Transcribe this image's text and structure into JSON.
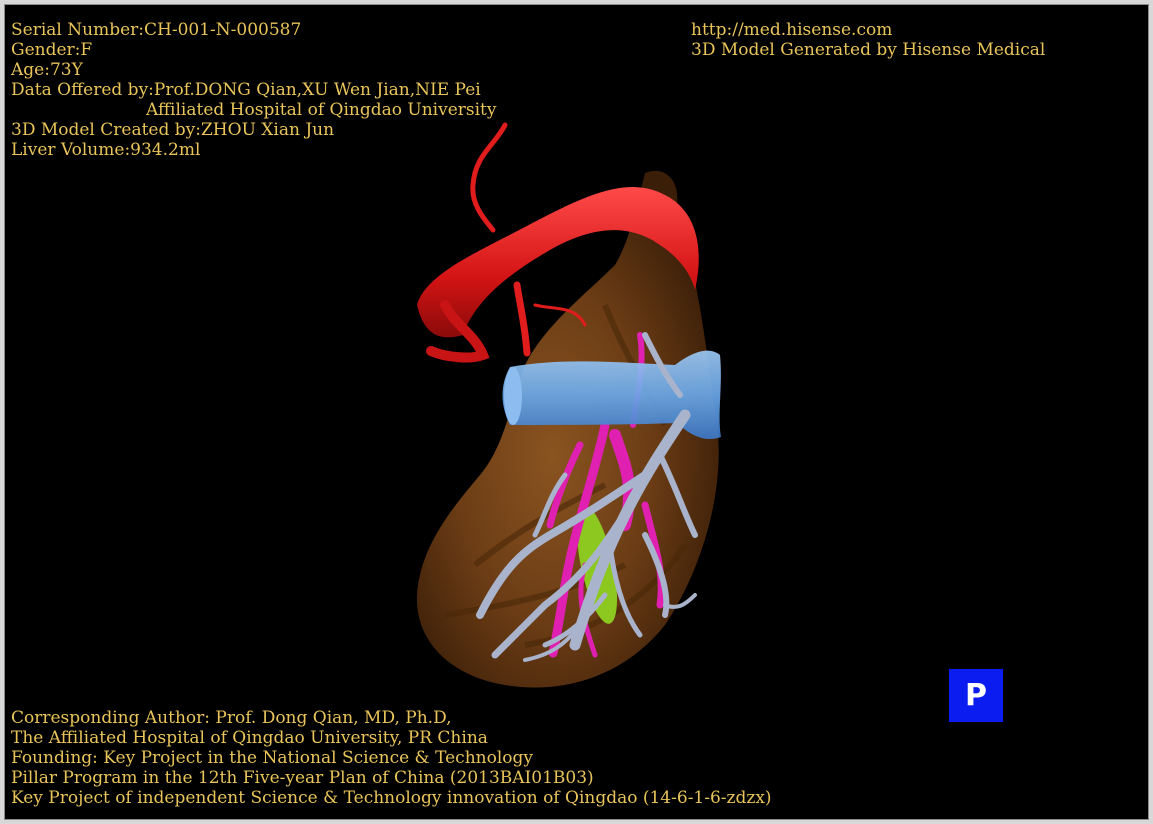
{
  "header_left": {
    "serial": "Serial Number:CH-001-N-000587",
    "gender": "Gender:F",
    "age": "Age:73Y",
    "data_offered": "Data Offered by:Prof.DONG Qian,XU Wen Jian,NIE Pei",
    "hospital": "Affiliated Hospital of Qingdao University",
    "model_created": "3D Model Created by:ZHOU Xian Jun",
    "liver_volume": "Liver Volume:934.2ml"
  },
  "header_right": {
    "url": "http://med.hisense.com",
    "generated_by": "3D Model Generated by Hisense Medical"
  },
  "footer": {
    "line1": "Corresponding Author: Prof. Dong Qian, MD, Ph.D,",
    "line2": "The Affiliated Hospital of Qingdao University, PR China",
    "line3": "Founding: Key Project in the National Science & Technology",
    "line4": "Pillar Program in the 12th Five-year Plan of China (2013BAI01B03)",
    "line5": "Key Project of independent Science & Technology innovation of Qingdao (14-6-1-6-zdzx)"
  },
  "orientation": {
    "label": "P"
  },
  "colors": {
    "text": "#e8c45a",
    "liver": "#6b3c15",
    "artery": "#e01616",
    "vena_cava": "#6aa8e8",
    "portal_vein": "#a9b4cc",
    "hepatic_vein": "#e020b0",
    "gallbladder": "#8cc820",
    "orientation_box": "#0a1cf0"
  }
}
